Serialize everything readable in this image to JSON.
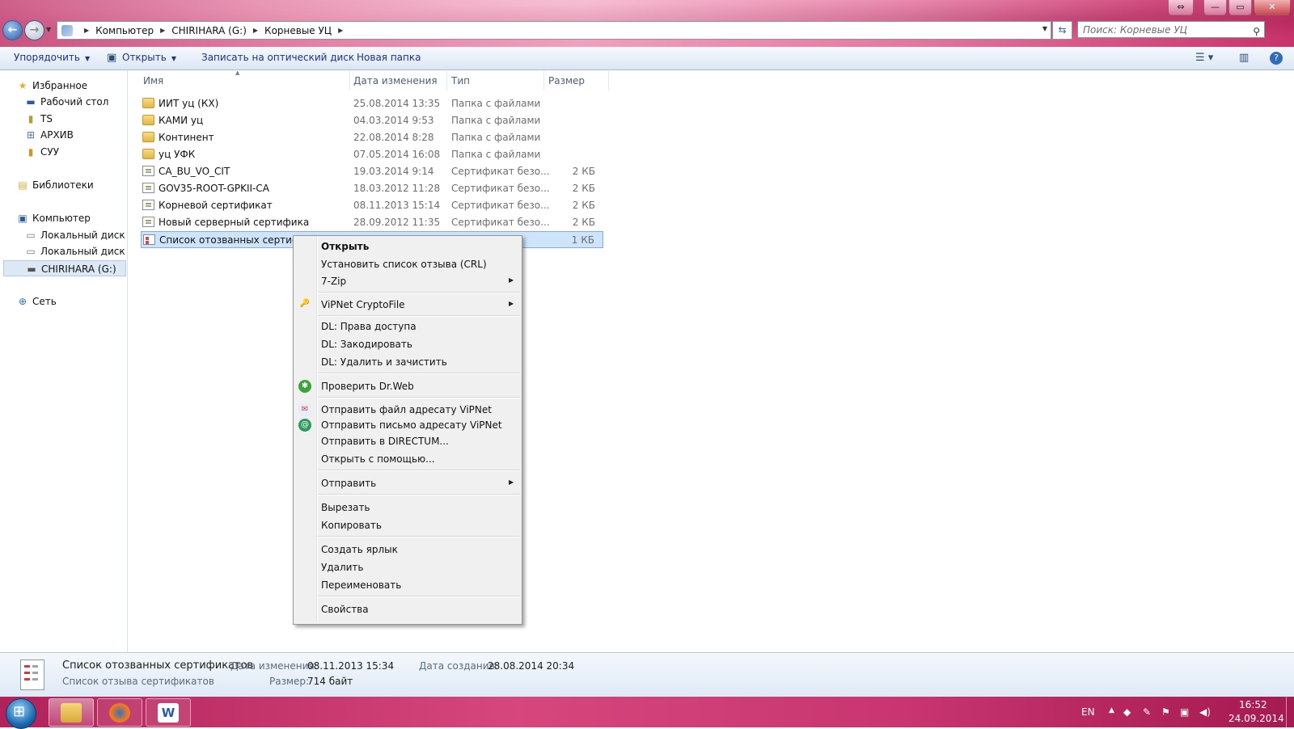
{
  "window": {
    "controls": {
      "minimize": "—",
      "maximize": "▭",
      "close": "✕",
      "resize": "⇔"
    }
  },
  "address": {
    "crumbs": [
      "Компьютер",
      "CHIRIHARA (G:)",
      "Корневые УЦ"
    ],
    "search_placeholder": "Поиск: Корневые УЦ"
  },
  "toolbar": {
    "organize": "Упорядочить",
    "open": "Открыть",
    "burn": "Записать на оптический диск",
    "new_folder": "Новая папка"
  },
  "sidebar": {
    "favorites": "Избранное",
    "desktop": "Рабочий стол",
    "ts": "TS",
    "archive": "АРХИВ",
    "cyy": "СУУ",
    "libraries": "Библиотеки",
    "computer": "Компьютер",
    "disk_c": "Локальный диск (C",
    "disk_d": "Локальный диск (D",
    "drive_g": "CHIRIHARA (G:)",
    "network": "Сеть"
  },
  "columns": {
    "name": "Имя",
    "date": "Дата изменения",
    "type": "Тип",
    "size": "Размер"
  },
  "files": [
    {
      "name": "ИИТ уц (КХ)",
      "date": "25.08.2014 13:35",
      "type": "Папка с файлами",
      "size": "",
      "kind": "folder"
    },
    {
      "name": "КАМИ уц",
      "date": "04.03.2014 9:53",
      "type": "Папка с файлами",
      "size": "",
      "kind": "folder"
    },
    {
      "name": "Континент",
      "date": "22.08.2014 8:28",
      "type": "Папка с файлами",
      "size": "",
      "kind": "folder"
    },
    {
      "name": "уц УФК",
      "date": "07.05.2014 16:08",
      "type": "Папка с файлами",
      "size": "",
      "kind": "folder"
    },
    {
      "name": "CA_BU_VO_CIT",
      "date": "19.03.2014 9:14",
      "type": "Сертификат безо...",
      "size": "2 КБ",
      "kind": "cert"
    },
    {
      "name": "GOV35-ROOT-GPKII-CA",
      "date": "18.03.2012 11:28",
      "type": "Сертификат безо...",
      "size": "2 КБ",
      "kind": "cert"
    },
    {
      "name": "Корневой сертификат",
      "date": "08.11.2013 15:14",
      "type": "Сертификат безо...",
      "size": "2 КБ",
      "kind": "cert"
    },
    {
      "name": "Новый серверный сертификат ООС",
      "date": "28.09.2012 11:35",
      "type": "Сертификат безо...",
      "size": "2 КБ",
      "kind": "cert"
    },
    {
      "name": "Список отозванных сертифик",
      "date": "",
      "type": "се...",
      "size": "1 КБ",
      "kind": "crl"
    }
  ],
  "context_menu": {
    "open": "Открыть",
    "install_crl": "Установить список отзыва (CRL)",
    "sevenzip": "7-Zip",
    "vipnet_cryptofile": "ViPNet CryptoFile",
    "dl_access": "DL: Права доступа",
    "dl_encode": "DL: Закодировать",
    "dl_delete": "DL: Удалить и зачистить",
    "drweb": "Проверить Dr.Web",
    "vipnet_send_file": "Отправить файл адресату ViPNet",
    "vipnet_send_letter": "Отправить письмо адресату ViPNet",
    "directum": "Отправить в DIRECTUM...",
    "open_with": "Открыть с помощью...",
    "send_to": "Отправить",
    "cut": "Вырезать",
    "copy": "Копировать",
    "shortcut": "Создать ярлык",
    "delete": "Удалить",
    "rename": "Переименовать",
    "properties": "Свойства"
  },
  "details": {
    "title": "Список отозванных сертификатов",
    "subtitle": "Список отзыва сертификатов",
    "modified_label": "Дата изменения:",
    "modified_value": "08.11.2013 15:34",
    "size_label": "Размер:",
    "size_value": "714 байт",
    "created_label": "Дата создания:",
    "created_value": "28.08.2014 20:34"
  },
  "taskbar": {
    "lang": "EN",
    "time": "16:52",
    "date": "24.09.2014",
    "word_letter": "W"
  }
}
